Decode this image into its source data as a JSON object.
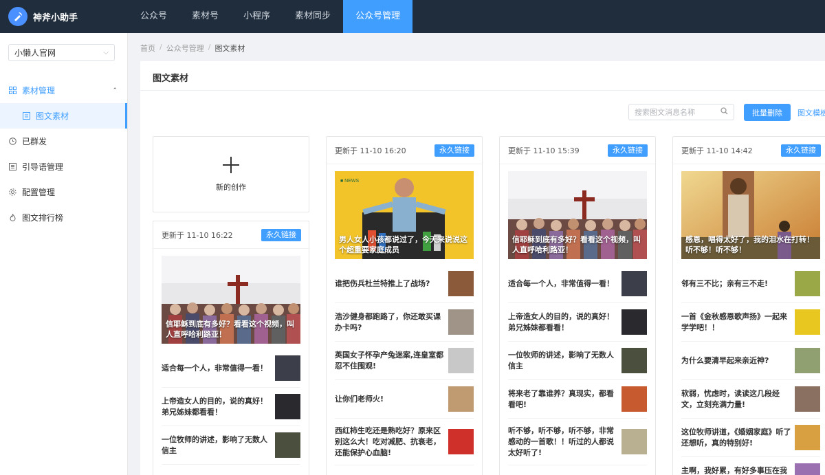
{
  "app": {
    "title": "神斧小助手"
  },
  "topnav": [
    {
      "label": "公众号",
      "active": false
    },
    {
      "label": "素材号",
      "active": false
    },
    {
      "label": "小程序",
      "active": false
    },
    {
      "label": "素材同步",
      "active": false
    },
    {
      "label": "公众号管理",
      "active": true
    }
  ],
  "sidebar": {
    "account": "小懒人官网",
    "menu": [
      {
        "label": "素材管理",
        "icon": "grid-icon"
      },
      {
        "label": "图文素材",
        "icon": "document-icon"
      },
      {
        "label": "已群发",
        "icon": "clock-icon"
      },
      {
        "label": "引导语管理",
        "icon": "list-icon"
      },
      {
        "label": "配置管理",
        "icon": "gear-icon"
      },
      {
        "label": "图文排行榜",
        "icon": "flame-icon"
      }
    ]
  },
  "breadcrumb": [
    "首页",
    "公众号管理",
    "图文素材"
  ],
  "panel": {
    "title": "图文素材",
    "search_placeholder": "搜索图文消息名称",
    "batch_delete": "批量删除",
    "template_link": "图文模板"
  },
  "new_card": {
    "label": "新的创作"
  },
  "cards": [
    {
      "time": "更新于 11-10 16:22",
      "badge": "永久链接",
      "cover": {
        "caption": "信耶稣到底有多好？看看这个视频，叫人直呼哈利路亚！",
        "style": "church"
      },
      "articles": [
        {
          "title": "适合每一个人，非常值得一看！",
          "thumb": "#3c3f4a"
        },
        {
          "title": "上帝造女人的目的，说的真好！弟兄姊妹都看看！",
          "thumb": "#2a2a2e"
        },
        {
          "title": "一位牧师的讲述，影响了无数人信主",
          "thumb": "#4a4f3e"
        }
      ]
    },
    {
      "time": "更新于 11-10 16:20",
      "badge": "永久链接",
      "cover": {
        "caption": "男人女人小孩都说过了，今天来说说这个超重要家庭成员",
        "style": "yellow"
      },
      "articles": [
        {
          "title": "谁把伤兵杜兰特推上了战场?",
          "thumb": "#8a5a3a"
        },
        {
          "title": "浩沙健身都跑路了，你还敢买课办卡吗?",
          "thumb": "#a09488"
        },
        {
          "title": "英国女子怀孕产兔迷案,连皇室都忍不住围观!",
          "thumb": "#c8c8c8"
        },
        {
          "title": "让你们老师火!",
          "thumb": "#c09a70"
        },
        {
          "title": "西红柿生吃还是熟吃好？原来区别这么大！吃对减肥、抗衰老，还能保护心血脑!",
          "thumb": "#d0302a"
        }
      ]
    },
    {
      "time": "更新于 11-10 15:39",
      "badge": "永久链接",
      "cover": {
        "caption": "信耶稣到底有多好？看看这个视频，叫人直呼哈利路亚！",
        "style": "church"
      },
      "articles": [
        {
          "title": "适合每一个人，非常值得一看！",
          "thumb": "#3c3f4a"
        },
        {
          "title": "上帝造女人的目的，说的真好！弟兄姊妹都看看！",
          "thumb": "#2a2a2e"
        },
        {
          "title": "一位牧师的讲述，影响了无数人信主",
          "thumb": "#4a4f3e"
        },
        {
          "title": "将来老了靠谁养？真现实，都看看吧!",
          "thumb": "#c85a30"
        },
        {
          "title": "听不够，听不够，听不够，非常感动的一首歌！！听过的人都说太好听了!",
          "thumb": "#b8b090"
        }
      ]
    },
    {
      "time": "更新于 11-10 14:42",
      "badge": "永久链接",
      "cover": {
        "caption": "感恩，唱得太好了，我的泪水在打转！听不够！听不够！",
        "style": "jesus"
      },
      "articles": [
        {
          "title": "邻有三不比；亲有三不走!",
          "thumb": "#9aa848"
        },
        {
          "title": "一首《金秋感恩歌声扬》一起来学学吧！！",
          "thumb": "#e8c820"
        },
        {
          "title": "为什么要清早起来亲近神?",
          "thumb": "#90a070"
        },
        {
          "title": "软弱，忧虑时，读读这几段经文，立刻充满力量!",
          "thumb": "#8a7060"
        },
        {
          "title": "这位牧师讲道，《婚姻家庭》听了还想听，真的特别好!",
          "thumb": "#d8a040"
        },
        {
          "title": "主啊，我好累，有好多事压在我身",
          "thumb": "#9a70b0"
        }
      ]
    }
  ]
}
